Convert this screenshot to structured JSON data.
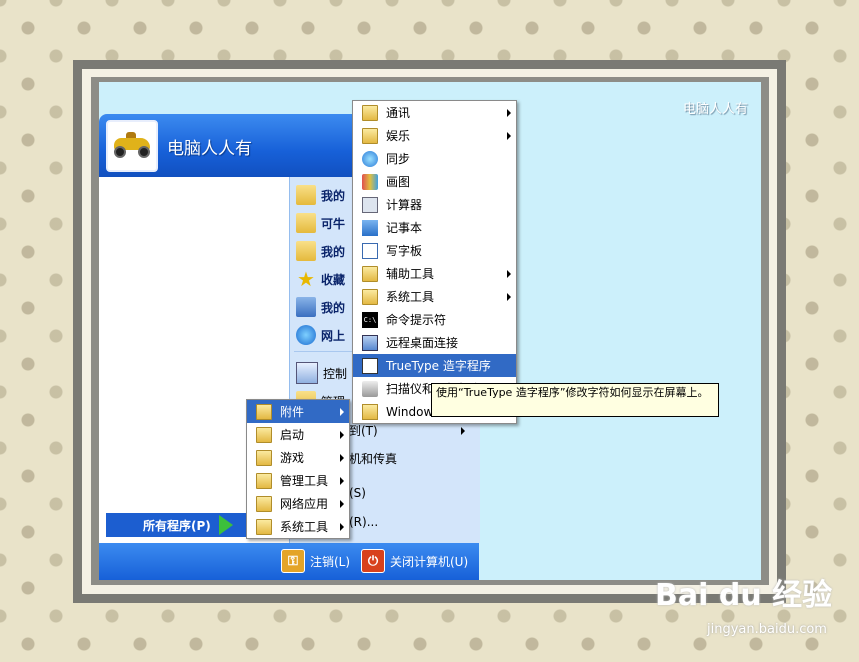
{
  "desktop": {
    "watermark": "电脑人人有"
  },
  "start_menu": {
    "username": "电脑人人有",
    "right_items": [
      {
        "label": "我的",
        "icon": "folder-icon"
      },
      {
        "label": "可牛",
        "icon": "folder-icon"
      },
      {
        "label": "我的",
        "icon": "folder-icon"
      },
      {
        "label": "收藏",
        "icon": "star-icon"
      },
      {
        "label": "我的",
        "icon": "computer-icon"
      },
      {
        "label": "网上",
        "icon": "network-icon"
      },
      {
        "label": "控制",
        "icon": "control-panel-icon"
      },
      {
        "label": "管理",
        "icon": "folder-icon"
      }
    ],
    "partial_labels": {
      "connect": "到(T)",
      "printers": "机和传真",
      "search": "(S)",
      "run": "(R)..."
    },
    "all_programs": "所有程序(P)",
    "logoff": "注销(L)",
    "shutdown": "关闭计算机(U)"
  },
  "programs_menu": [
    {
      "label": "附件",
      "submenu": true,
      "selected": true
    },
    {
      "label": "启动",
      "submenu": true
    },
    {
      "label": "游戏",
      "submenu": true
    },
    {
      "label": "管理工具",
      "submenu": true
    },
    {
      "label": "网络应用",
      "submenu": true
    },
    {
      "label": "系统工具",
      "submenu": true
    }
  ],
  "accessories_menu": [
    {
      "label": "通讯",
      "submenu": true,
      "icon": "folder-icon"
    },
    {
      "label": "娱乐",
      "submenu": true,
      "icon": "folder-icon"
    },
    {
      "label": "同步",
      "submenu": false,
      "icon": "sync-icon"
    },
    {
      "label": "画图",
      "submenu": false,
      "icon": "paint-icon"
    },
    {
      "label": "计算器",
      "submenu": false,
      "icon": "calculator-icon"
    },
    {
      "label": "记事本",
      "submenu": false,
      "icon": "notepad-icon"
    },
    {
      "label": "写字板",
      "submenu": false,
      "icon": "wordpad-icon"
    },
    {
      "label": "辅助工具",
      "submenu": true,
      "icon": "folder-icon"
    },
    {
      "label": "系统工具",
      "submenu": true,
      "icon": "folder-icon"
    },
    {
      "label": "命令提示符",
      "submenu": false,
      "icon": "cmd-icon"
    },
    {
      "label": "远程桌面连接",
      "submenu": false,
      "icon": "remote-desktop-icon"
    },
    {
      "label": "TrueType 造字程序",
      "submenu": false,
      "icon": "truetype-editor-icon",
      "selected": true
    },
    {
      "label": "扫描仪和照相机向导",
      "submenu": false,
      "icon": "scanner-icon"
    },
    {
      "label": "Windows",
      "submenu": false,
      "icon": "folder-icon"
    }
  ],
  "tooltip": "使用“TrueType 造字程序”修改字符如何显示在屏幕上。",
  "watermark": {
    "brand": "Bai du 经验",
    "url": "jingyan.baidu.com"
  }
}
